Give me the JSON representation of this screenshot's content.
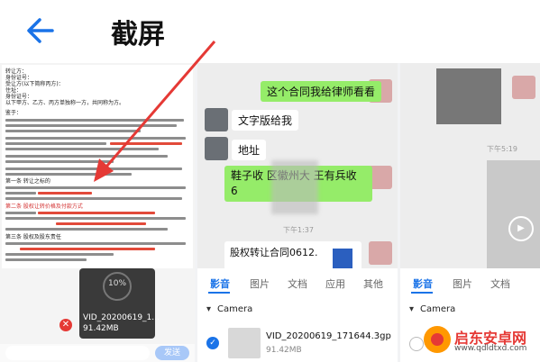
{
  "header": {
    "title": "截屏"
  },
  "panel1": {
    "doc_lines": [
      "转让方：",
      "身份证号：",
      "受让方(以下简称丙方)：",
      "住址：",
      "身份证号：",
      "以下甲方、乙方、丙方单独称一方，共同称为方。",
      "鉴于：",
      "第一条 转让之标的",
      "第二条 股权让转价格及付款方式",
      "第三条 股权及股东责任"
    ],
    "video": {
      "duration": "10%",
      "filename": "VID_20200619_1...",
      "size": "91.42MB"
    },
    "send_label": "发送"
  },
  "panel2": {
    "messages": [
      {
        "text": "这个合同我给律师看看",
        "side": "right"
      },
      {
        "text": "文字版给我",
        "side": "left"
      },
      {
        "text": "地址",
        "side": "left"
      },
      {
        "text": "鞋子收  区徽州大  王有兵收  6",
        "side": "right"
      }
    ],
    "time": "下午1:37",
    "file_card": {
      "name": "股权转让合同0612."
    },
    "tabs": [
      "影音",
      "图片",
      "文档",
      "应用",
      "其他"
    ],
    "folder": "Camera",
    "file": {
      "name": "VID_20200619_171644.3gp",
      "size": "91.42MB"
    }
  },
  "panel3": {
    "time": "下午5:19",
    "tabs": [
      "影音",
      "图片",
      "文档"
    ],
    "folder": "Camera",
    "watermark": {
      "title": "启东安卓网",
      "url": "www.qdldtxd.com"
    }
  },
  "colors": {
    "accent": "#1a73e8",
    "bubble_green": "#95ec69",
    "arrow": "#e53935"
  }
}
